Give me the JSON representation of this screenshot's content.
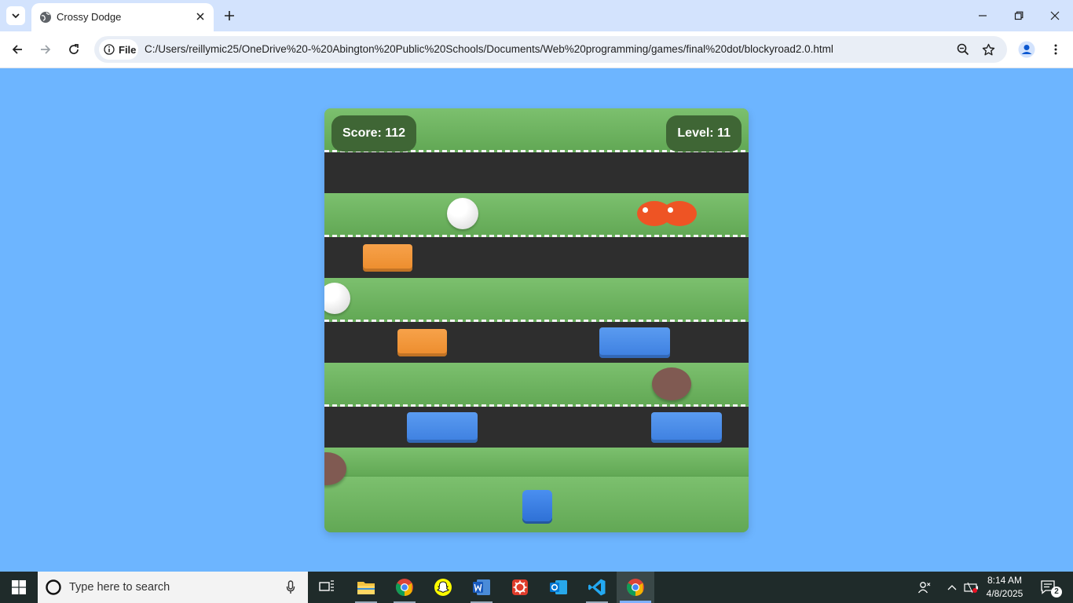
{
  "browser": {
    "tab_title": "Crossy Dodge",
    "url": "C:/Users/reillymic25/OneDrive%20-%20Abington%20Public%20Schools/Documents/Web%20programming/games/final%20dot/blockyroad2.0.html",
    "security_chip_label": "File"
  },
  "game": {
    "score_label": "Score: 112",
    "level_label": "Level: 11",
    "score": 112,
    "level": 11,
    "colors": {
      "background": "#6db5ff",
      "grass": "#6db561",
      "road": "#2e2e2e",
      "hud": "#3f6635",
      "car_orange": "#ec8c2c",
      "car_blue": "#3d7fe0",
      "player": "#3a7fe0"
    }
  },
  "taskbar": {
    "search_placeholder": "Type here to search",
    "time": "8:14 AM",
    "date": "4/8/2025",
    "notification_count": "2",
    "apps": [
      "task-view",
      "file-explorer",
      "chrome",
      "snapchat",
      "word",
      "app-red",
      "outlook",
      "vscode",
      "chrome-active"
    ]
  }
}
